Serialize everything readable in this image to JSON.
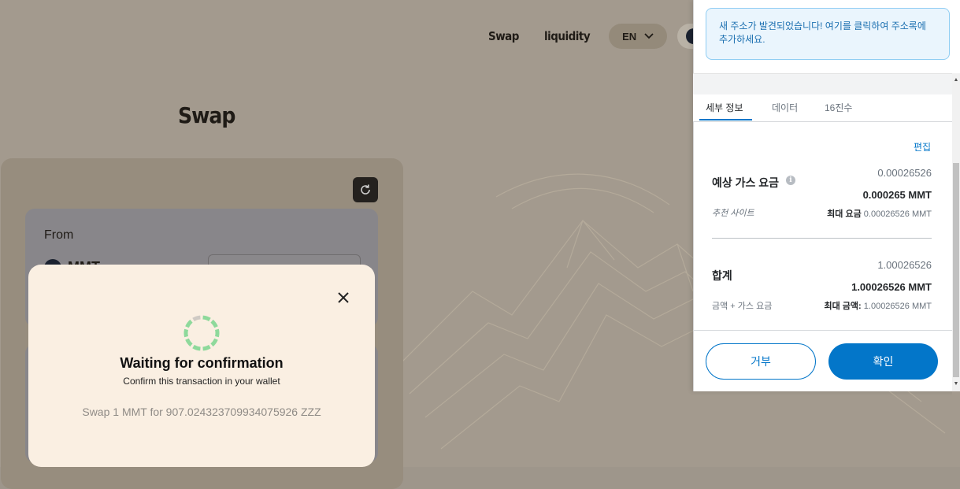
{
  "nav": {
    "swap": "Swap",
    "liquidity": "liquidity",
    "language": "EN"
  },
  "swap_page": {
    "title": "Swap",
    "from_label": "From",
    "from_token": "MMT"
  },
  "modal": {
    "heading": "Waiting for confirmation",
    "subtitle": "Confirm this transaction in your wallet",
    "swap_summary": "Swap 1 MMT for 907.024323709934075926 ZZZ"
  },
  "wallet": {
    "notice": "새 주소가 발견되었습니다! 여기를 클릭하여 주소록에 추가하세요.",
    "tabs": [
      "세부 정보",
      "데이터",
      "16진수"
    ],
    "edit": "편집",
    "gas": {
      "label": "예상 가스 요금",
      "value_gray": "0.00026526",
      "value_bold": "0.000265 MMT",
      "site_suggested": "추천 사이트",
      "max_fee_label": "최대 요금",
      "max_fee_value": "0.00026526 MMT"
    },
    "total": {
      "label": "합계",
      "value_gray": "1.00026526",
      "value_bold": "1.00026526 MMT",
      "sub_label": "금액 + 가스 요금",
      "max_amount_label": "최대 금액:",
      "max_amount_value": "1.00026526 MMT"
    },
    "reject": "거부",
    "confirm": "확인"
  },
  "colors": {
    "wallet_blue": "#0376c9",
    "spinner_green": "#8ed99b",
    "modal_bg": "#faefe2"
  }
}
